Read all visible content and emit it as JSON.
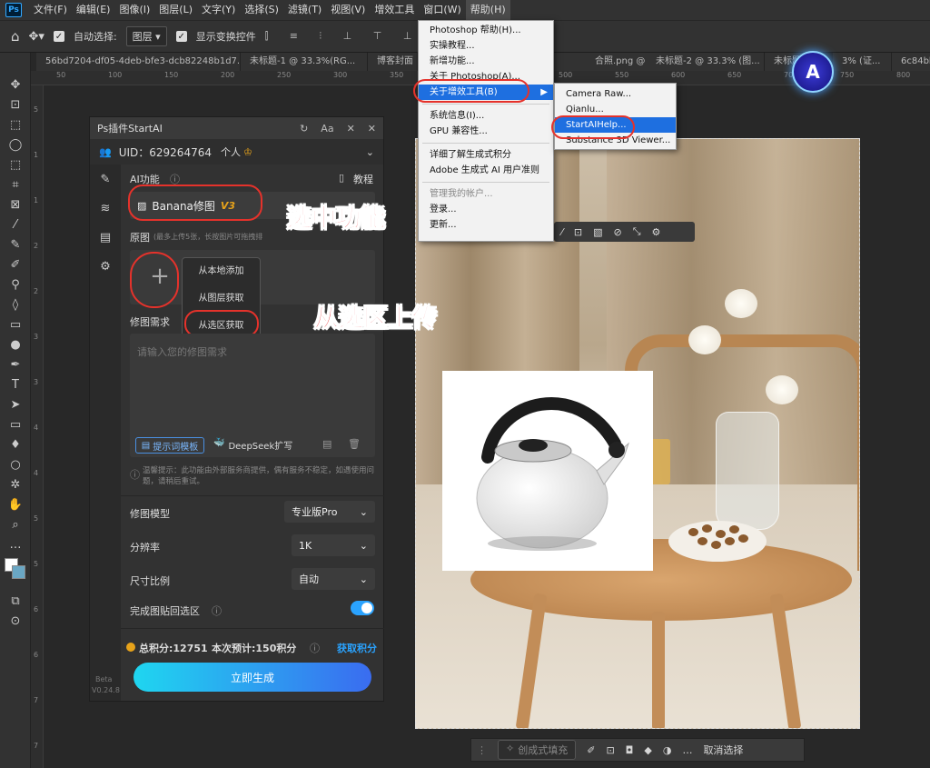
{
  "menubar": {
    "logo": "Ps",
    "items": [
      "文件(F)",
      "编辑(E)",
      "图像(I)",
      "图层(L)",
      "文字(Y)",
      "选择(S)",
      "滤镜(T)",
      "视图(V)",
      "增效工具",
      "窗口(W)",
      "帮助(H)"
    ]
  },
  "options": {
    "auto_select": "自动选择:",
    "layer": "图层",
    "show_transform": "显示变换控件"
  },
  "tabs": [
    "56bd7204-df05-4deb-bfe3-dcb82248b1d7.jpg",
    "未标题-1 @ 33.3%(RG...",
    "博客封面",
    "合照.png @ 12....",
    "未标题-2 @ 33.3% (图...",
    "未标题",
    "3% (证...",
    "6c84bb"
  ],
  "ruler_top": [
    "50",
    "100",
    "150",
    "200",
    "250",
    "300",
    "350",
    "400",
    "450",
    "500",
    "550",
    "600",
    "650",
    "700",
    "750",
    "800"
  ],
  "ruler_left": [
    "5",
    "1",
    "1",
    "2",
    "2",
    "3",
    "3",
    "4",
    "4",
    "5",
    "5",
    "6",
    "6",
    "7",
    "7"
  ],
  "help_menu": {
    "items": [
      "Photoshop 帮助(H)...",
      "实操教程...",
      "新增功能...",
      "关于 Photoshop(A)...",
      "关于增效工具(B)",
      "系统信息(I)...",
      "GPU 兼容性...",
      "详细了解生成式积分",
      "Adobe 生成式 AI 用户准则",
      "管理我的帐户...",
      "登录...",
      "更新..."
    ]
  },
  "sub_menu": {
    "items": [
      "Camera Raw...",
      "Qianlu...",
      "StartAIHelp...",
      "Substance 3D Viewer..."
    ]
  },
  "panel": {
    "title": "Ps插件StartAI",
    "uid_label": "UID：629264764",
    "user_type": "个人",
    "crown": "♔",
    "ai_func_label": "AI功能",
    "tutorial": "教程",
    "feature_name": "Banana修图",
    "feature_version": "V3",
    "source_label": "原图",
    "source_hint": "(最多上传5张，长按图片可拖拽排",
    "dropdown": [
      "从本地添加",
      "从图层获取",
      "从选区获取"
    ],
    "req_label": "修图需求",
    "req_placeholder": "请输入您的修图需求",
    "prompt_template": "提示词模板",
    "deepseek": "DeepSeek扩写",
    "notice": "温馨提示：此功能由外部服务商提供，偶有服务不稳定，如遇使用问题，请稍后重试。",
    "model_label": "修图模型",
    "model_value": "专业版Pro",
    "res_label": "分辨率",
    "res_value": "1K",
    "ratio_label": "尺寸比例",
    "ratio_value": "自动",
    "paste_label": "完成图贴回选区",
    "paste_on": true,
    "points_total": "总积分:12751",
    "points_est": "本次预计:150积分",
    "get_points": "获取积分",
    "generate": "立即生成",
    "beta": "Beta",
    "version": "V0.24.8"
  },
  "annotations": {
    "select_feature": "选中功能",
    "upload_from_selection": "从选区上传"
  },
  "bottom_bar": {
    "gen_fill": "创成式填充",
    "deselect": "取消选择"
  },
  "colors": {
    "accent_blue": "#2aa3ff",
    "generate_gradient_start": "#1fd6f0",
    "generate_gradient_end": "#3a6cf0",
    "annotation_red": "#e8262a",
    "gold": "#e6a21a"
  }
}
